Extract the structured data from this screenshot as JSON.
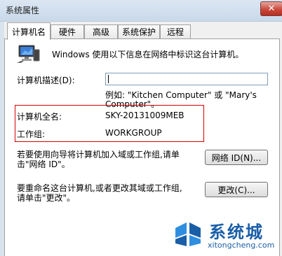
{
  "window": {
    "title": "系统属性"
  },
  "tabs": [
    {
      "label": "计算机名"
    },
    {
      "label": "硬件"
    },
    {
      "label": "高级"
    },
    {
      "label": "系统保护"
    },
    {
      "label": "远程"
    }
  ],
  "panel": {
    "intro": "Windows 使用以下信息在网络中标识这台计算机。",
    "description_label": "计算机描述(D):",
    "description_value": "",
    "example_line1": "例如: \"Kitchen Computer\" 或 \"Mary's",
    "example_line2": "Computer\"。",
    "fullname_label": "计算机全名:",
    "fullname_value": "SKY-20131009MEB",
    "workgroup_label": "工作组:",
    "workgroup_value": "WORKGROUP",
    "wizard_text_line1": "若要使用向导将计算机加入域或工作组,请单",
    "wizard_text_line2": "击\"网络 ID\"。",
    "network_id_button": "网络 ID(N)...",
    "rename_text_line1": "要重命名这台计算机,或者更改其域或工作组,",
    "rename_text_line2": "请单击\"更改\"。",
    "change_button": "更改(C)..."
  },
  "watermark": {
    "site_name": "系统城",
    "url": "xitongcheng.com"
  },
  "colors": {
    "highlight_box": "#d90000",
    "logo_blue": "#1a5ea8"
  }
}
